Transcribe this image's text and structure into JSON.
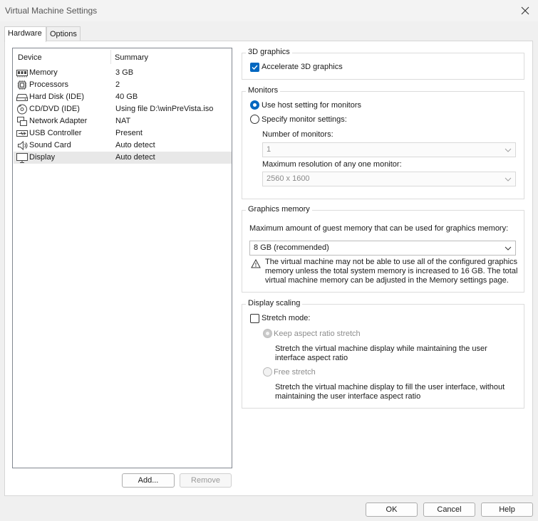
{
  "window": {
    "title": "Virtual Machine Settings"
  },
  "tabs": [
    {
      "label": "Hardware",
      "active": true
    },
    {
      "label": "Options",
      "active": false
    }
  ],
  "device_list": {
    "columns": {
      "device": "Device",
      "summary": "Summary"
    },
    "rows": [
      {
        "name": "Memory",
        "summary": "3 GB",
        "icon": "memory-icon"
      },
      {
        "name": "Processors",
        "summary": "2",
        "icon": "processor-icon"
      },
      {
        "name": "Hard Disk (IDE)",
        "summary": "40 GB",
        "icon": "hard-disk-icon"
      },
      {
        "name": "CD/DVD (IDE)",
        "summary": "Using file D:\\winPreVista.iso",
        "icon": "cd-dvd-icon"
      },
      {
        "name": "Network Adapter",
        "summary": "NAT",
        "icon": "network-adapter-icon"
      },
      {
        "name": "USB Controller",
        "summary": "Present",
        "icon": "usb-icon"
      },
      {
        "name": "Sound Card",
        "summary": "Auto detect",
        "icon": "speaker-icon"
      },
      {
        "name": "Display",
        "summary": "Auto detect",
        "icon": "display-icon",
        "selected": true
      }
    ],
    "add_label": "Add...",
    "remove_label": "Remove"
  },
  "graphics3d": {
    "title": "3D graphics",
    "accelerate_label": "Accelerate 3D graphics",
    "accelerate_checked": true
  },
  "monitors": {
    "title": "Monitors",
    "use_host_label": "Use host setting for monitors",
    "specify_label": "Specify monitor settings:",
    "selected": "use_host",
    "num_label": "Number of monitors:",
    "num_value": "1",
    "res_label": "Maximum resolution of any one monitor:",
    "res_value": "2560 x 1600"
  },
  "graphics_memory": {
    "title": "Graphics memory",
    "description": "Maximum amount of guest memory that can be used for graphics memory:",
    "value": "8 GB (recommended)",
    "warning": "The virtual machine may not be able to use all of the configured graphics memory unless the total system memory is increased to 16 GB. The total virtual machine memory can be adjusted in the Memory settings page."
  },
  "display_scaling": {
    "title": "Display scaling",
    "stretch_label": "Stretch mode:",
    "stretch_checked": false,
    "keep_label": "Keep aspect ratio stretch",
    "keep_desc": "Stretch the virtual machine display while maintaining the user interface aspect ratio",
    "free_label": "Free stretch",
    "free_desc": "Stretch the virtual machine display to fill the user interface, without maintaining the user interface aspect ratio"
  },
  "footer": {
    "ok": "OK",
    "cancel": "Cancel",
    "help": "Help"
  },
  "colors": {
    "accent": "#0067c0",
    "selected_row": "#e8e8e8"
  }
}
